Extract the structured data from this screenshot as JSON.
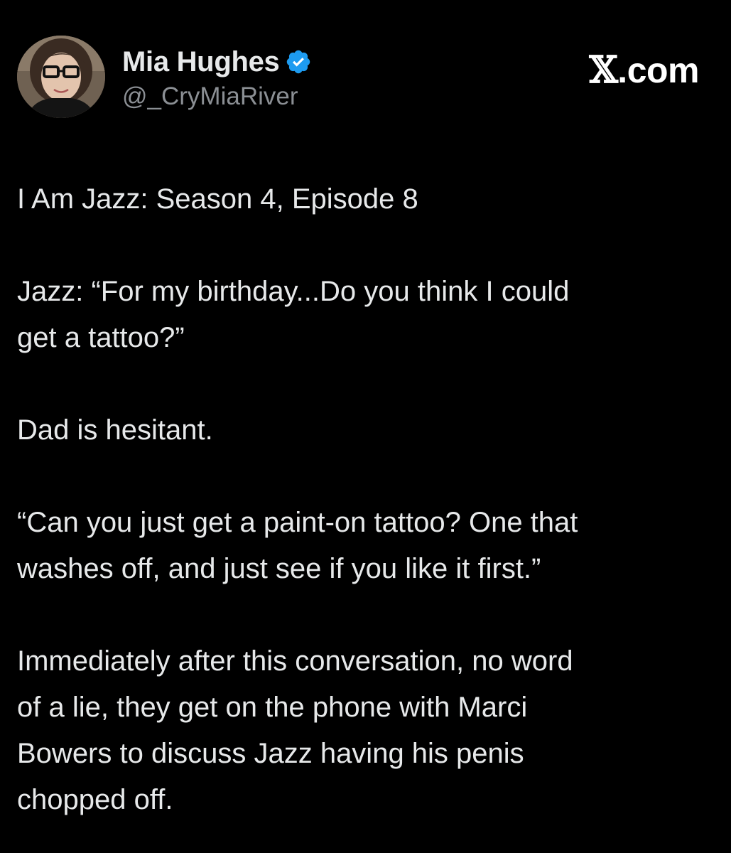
{
  "author": {
    "display_name": "Mia Hughes",
    "handle": "@_CryMiaRiver",
    "verified": true,
    "verified_color": "#1d9bf0"
  },
  "brand": {
    "x_glyph": "𝕏",
    "domain_suffix": ".com"
  },
  "tweet": {
    "paragraphs": [
      {
        "lines": [
          "I Am Jazz: Season 4, Episode 8"
        ]
      },
      {
        "lines": [
          "Jazz: “For my birthday...Do you think I could",
          "get a tattoo?”"
        ]
      },
      {
        "lines": [
          "Dad is hesitant."
        ]
      },
      {
        "lines": [
          "“Can you just get a paint-on tattoo? One that",
          "washes off, and just see if you like it first.”"
        ]
      },
      {
        "lines": [
          "Immediately after this conversation, no word",
          "of a lie, they get on the phone with Marci",
          "Bowers to discuss Jazz having his penis",
          "chopped off."
        ]
      }
    ]
  },
  "colors": {
    "background": "#000000",
    "text": "#e7e9ea",
    "secondary_text": "#8b8f94"
  }
}
